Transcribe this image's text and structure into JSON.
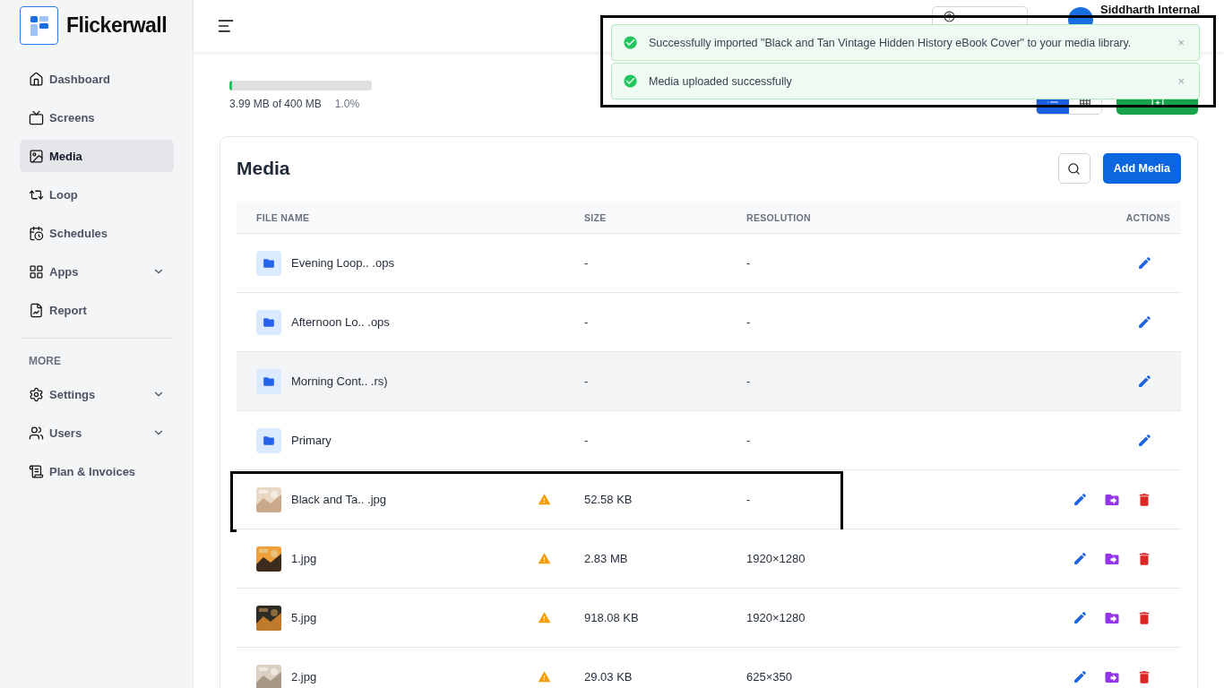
{
  "brand": {
    "name": "Flickerwall"
  },
  "sidebar": {
    "items": [
      {
        "label": "Dashboard",
        "selected": false,
        "expandable": false
      },
      {
        "label": "Screens",
        "selected": false,
        "expandable": false
      },
      {
        "label": "Media",
        "selected": true,
        "expandable": false
      },
      {
        "label": "Loop",
        "selected": false,
        "expandable": false
      },
      {
        "label": "Schedules",
        "selected": false,
        "expandable": false
      },
      {
        "label": "Apps",
        "selected": false,
        "expandable": true
      },
      {
        "label": "Report",
        "selected": false,
        "expandable": false
      }
    ],
    "section_title": "MORE",
    "more_items": [
      {
        "label": "Settings",
        "selected": false,
        "expandable": true
      },
      {
        "label": "Users",
        "selected": false,
        "expandable": true
      },
      {
        "label": "Plan & Invoices",
        "selected": false,
        "expandable": false
      }
    ]
  },
  "header": {
    "user_name": "Siddharth Internal"
  },
  "storage": {
    "used": "3.99 MB of 400 MB",
    "percent": "1.0%",
    "level": 0.01
  },
  "view_toggle": [
    {
      "kind": "list",
      "selected": true
    },
    {
      "kind": "grid",
      "selected": false
    }
  ],
  "toasts": {
    "highlighted": true,
    "items": [
      {
        "message": "Successfully imported \"Black and Tan Vintage Hidden History eBook Cover\" to your media library.",
        "close": "×"
      },
      {
        "message": "Media uploaded successfully",
        "close": "×"
      }
    ]
  },
  "media": {
    "title": "Media",
    "add_button": "Add Media",
    "columns": [
      "FILE NAME",
      "SIZE",
      "RESOLUTION",
      "ACTIONS"
    ],
    "rows": [
      {
        "kind": "folder",
        "name": "Evening Loop.. .ops",
        "size": "-",
        "resolution": "-",
        "hovered": false,
        "highlighted": false,
        "warning": false
      },
      {
        "kind": "folder",
        "name": "Afternoon Lo.. .ops",
        "size": "-",
        "resolution": "-",
        "hovered": false,
        "highlighted": false,
        "warning": false
      },
      {
        "kind": "folder",
        "name": "Morning Cont.. .rs)",
        "size": "-",
        "resolution": "-",
        "hovered": true,
        "highlighted": false,
        "warning": false
      },
      {
        "kind": "folder",
        "name": "Primary",
        "size": "-",
        "resolution": "-",
        "hovered": false,
        "highlighted": false,
        "warning": false
      },
      {
        "kind": "file",
        "name": "Black and Ta.. .jpg",
        "size": "52.58 KB",
        "resolution": "-",
        "hovered": false,
        "highlighted": true,
        "warning": true
      },
      {
        "kind": "file",
        "name": "1.jpg",
        "size": "2.83 MB",
        "resolution": "1920×1280",
        "hovered": false,
        "highlighted": false,
        "warning": true
      },
      {
        "kind": "file",
        "name": "5.jpg",
        "size": "918.08 KB",
        "resolution": "1920×1280",
        "hovered": false,
        "highlighted": false,
        "warning": true
      },
      {
        "kind": "file",
        "name": "2.jpg",
        "size": "29.03 KB",
        "resolution": "625×350",
        "hovered": false,
        "highlighted": false,
        "warning": true
      }
    ]
  }
}
